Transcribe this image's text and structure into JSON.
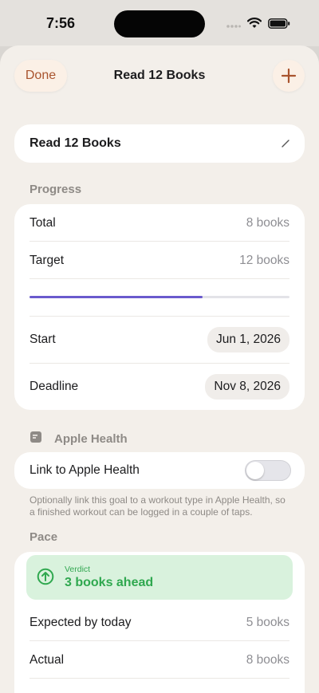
{
  "status": {
    "time": "7:56"
  },
  "nav": {
    "done_label": "Done",
    "title": "Read 12 Books"
  },
  "goal": {
    "name": "Read 12 Books"
  },
  "progress": {
    "section_label": "Progress",
    "total_label": "Total",
    "total_value": "8 books",
    "target_label": "Target",
    "target_value": "12 books",
    "fraction": 0.667,
    "start_label": "Start",
    "start_value": "Jun 1, 2026",
    "deadline_label": "Deadline",
    "deadline_value": "Nov 8, 2026",
    "accent_color": "#6a5acd"
  },
  "health": {
    "section_label": "Apple Health",
    "link_label": "Link to Apple Health",
    "link_enabled": false,
    "footnote": "Optionally link this goal to a workout type in Apple Health, so a finished workout can be logged in a couple of taps."
  },
  "pace": {
    "section_label": "Pace",
    "verdict_label": "Verdict",
    "verdict_text": "3 books ahead",
    "verdict_color": "#2fa84f",
    "expected_label": "Expected by today",
    "expected_value": "5 books",
    "actual_label": "Actual",
    "actual_value": "8 books"
  }
}
